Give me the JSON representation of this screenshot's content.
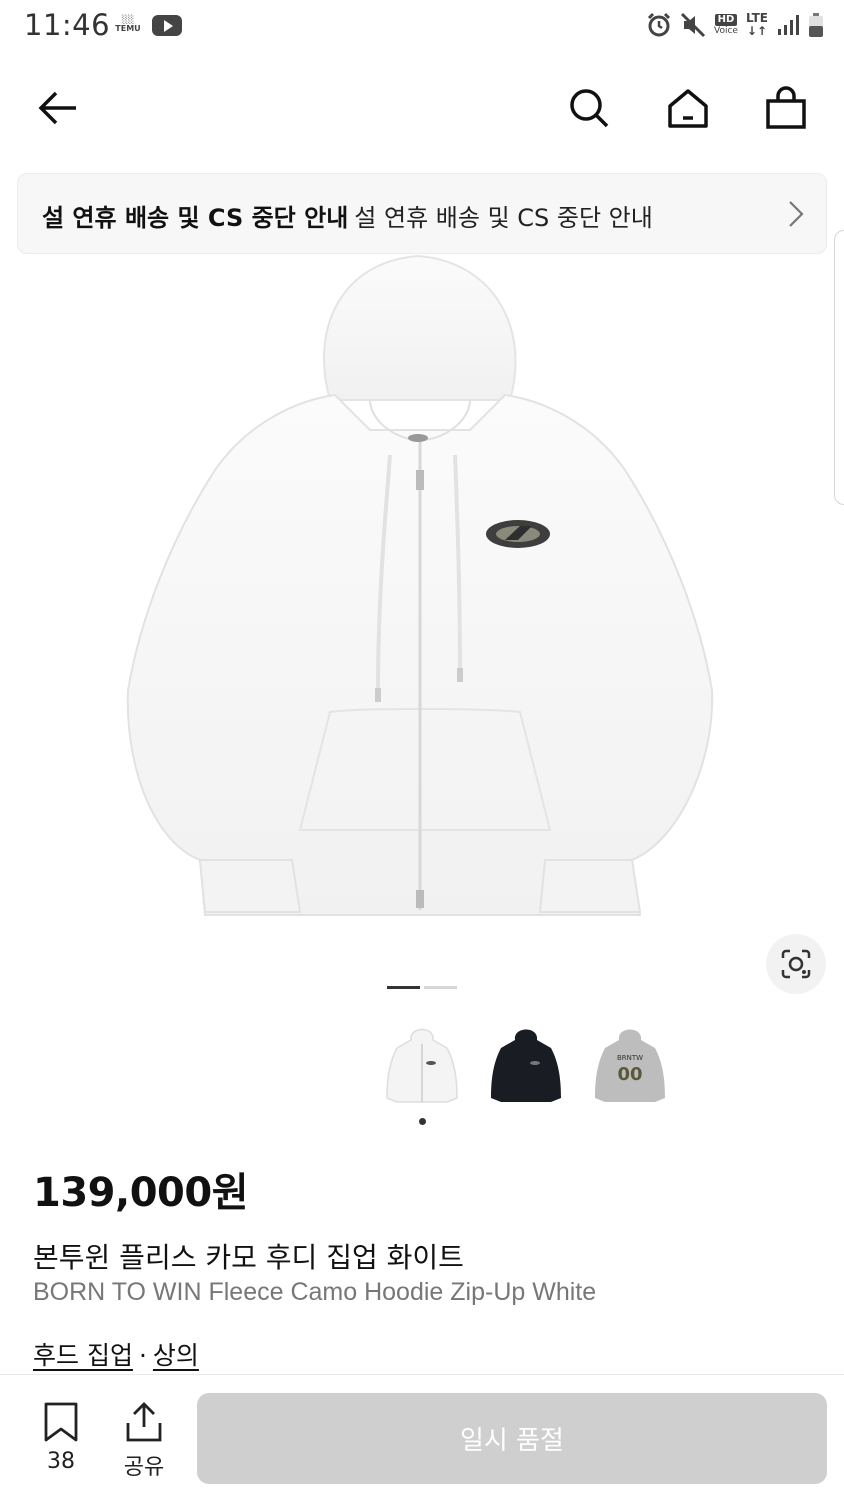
{
  "status_bar": {
    "time": "11:46",
    "apps": [
      "temu-icon",
      "youtube-icon"
    ],
    "temu_label": "TEMU",
    "hd": "HD",
    "voice": "Voice",
    "network": "LTE"
  },
  "nav": {
    "icons": [
      "back-arrow-icon",
      "search-icon",
      "home-icon",
      "shopping-bag-icon"
    ]
  },
  "notice": {
    "bold_text": "설  연휴 배송 및 CS 중단 안내",
    "normal_text": "설  연휴 배송 및 CS 중단 안내"
  },
  "gallery": {
    "image_label": "BORN TO WIN Fleece Camo Hoodie Zip-Up White",
    "pager_total": 2,
    "pager_active": 1,
    "thumbnail_colors": [
      "#f2f2f2",
      "#1a1c24",
      "#b8b8b8"
    ],
    "back_print_text": "BRNTW",
    "back_print_number": "00"
  },
  "product": {
    "price": "139,000원",
    "title_ko": "본투윈 플리스 카모 후디 집업 화이트",
    "title_en": "BORN TO WIN Fleece Camo Hoodie Zip-Up White",
    "categories": [
      "후드 집업",
      "상의"
    ],
    "separator": "·"
  },
  "bottom_bar": {
    "wishlist_count": "38",
    "share_label": "공유",
    "cta_label": "일시 품절",
    "cta_color": "#cfcfcf"
  }
}
